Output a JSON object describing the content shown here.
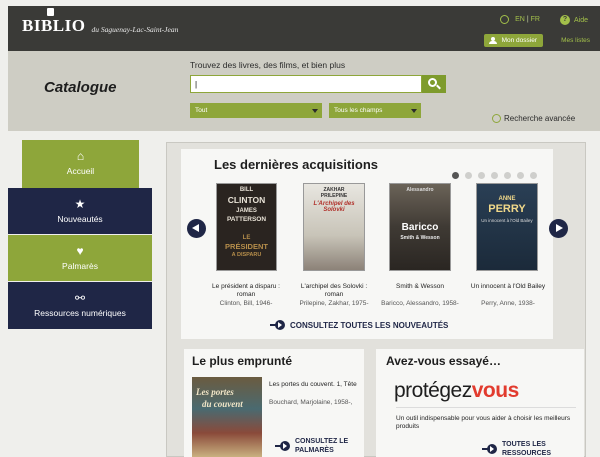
{
  "header": {
    "logo_main": "BIBLIO",
    "logo_sub": "du Saguenay-Lac-Saint-Jean",
    "lang_en": "EN",
    "lang_sep": "|",
    "lang_fr": "FR",
    "help_label": "Aide",
    "my_account_label": "Mon dossier",
    "my_lists_label": "Mes listes"
  },
  "search": {
    "catalogue_title": "Catalogue",
    "prompt": "Trouvez des livres, des films, et bien plus",
    "input_value": "|",
    "type_select": "Tout",
    "field_select": "Tous les champs",
    "advanced_link": "Recherche avancée"
  },
  "nav": {
    "items": [
      {
        "label": "Accueil",
        "icon": "home-icon"
      },
      {
        "label": "Nouveautés",
        "icon": "star-icon"
      },
      {
        "label": "Palmarès",
        "icon": "heart-icon"
      },
      {
        "label": "Ressources numériques",
        "icon": "link-icon"
      }
    ]
  },
  "acquisitions": {
    "title": "Les dernières acquisitions",
    "carousel_position": 1,
    "carousel_count": 7,
    "books": [
      {
        "cover_lines": [
          "BILL",
          "CLINTON",
          "JAMES",
          "PATTERSON",
          "LE",
          "PRÉSIDENT",
          "A DISPARU"
        ],
        "title": "Le président a disparu : roman",
        "author": "Clinton, Bill, 1946-"
      },
      {
        "cover_lines": [
          "ZAKHAR",
          "PRILEPINE",
          "L'Archipel des Solovki"
        ],
        "title": "L'archipel des Solovki : roman",
        "author": "Prilepine, Zakhar, 1975-"
      },
      {
        "cover_lines": [
          "Alessandro",
          "Baricco",
          "Smith & Wesson"
        ],
        "title": "Smith & Wesson",
        "author": "Baricco, Alessandro, 1958-"
      },
      {
        "cover_lines": [
          "ANNE",
          "PERRY",
          "Un innocent à l'Old Bailey"
        ],
        "title": "Un innocent à l'Old Bailey",
        "author": "Perry, Anne, 1938-"
      }
    ],
    "cta": "CONSULTEZ TOUTES LES NOUVEAUTÉS"
  },
  "popular": {
    "title": "Le plus emprunté",
    "cover_text_1": "Les portes",
    "cover_text_2": "du couvent",
    "book_title": "Les portes du couvent. 1, Tête",
    "book_author": "Bouchard, Marjolaine, 1958-,",
    "cta_line1": "CONSULTEZ LE",
    "cta_line2": "PALMARÈS"
  },
  "try": {
    "title": "Avez-vous essayé…",
    "logo_part1": "protégez",
    "logo_part2": "vous",
    "description": "Un outil indispensable pour vous aider à choisir les meilleurs produits",
    "cta_line1": "TOUTES LES",
    "cta_line2": "RESSOURCES"
  },
  "colors": {
    "green": "#8ea63a",
    "navy": "#1f2646",
    "topbar": "#3a3a37"
  }
}
